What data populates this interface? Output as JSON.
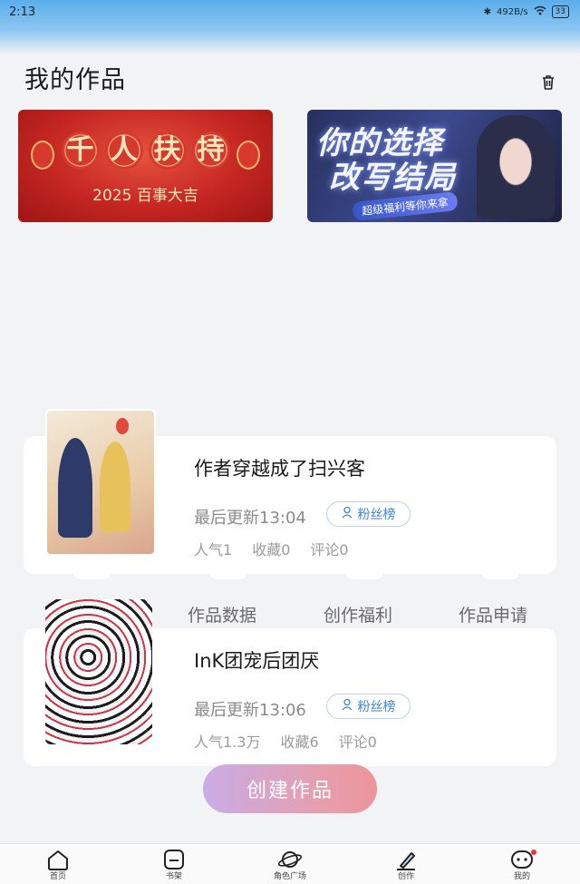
{
  "status_bar": {
    "time": "2:13",
    "network_speed": "492B/s",
    "battery": "33"
  },
  "page": {
    "title": "我的作品"
  },
  "banners": [
    {
      "chars": [
        "千",
        "人",
        "扶",
        "持"
      ],
      "subtitle": "2025 百事大吉"
    },
    {
      "title_line1": "你的选择",
      "title_line2": "改写结局",
      "tagline": "超级福利等你来拿"
    }
  ],
  "works": [
    {
      "title": "作者穿越成了扫兴客",
      "updated": "最后更新13:04",
      "fans_label": "粉丝榜",
      "stats": [
        "人气1",
        "收藏0",
        "评论0"
      ]
    },
    {
      "title": "InK团宠后团厌",
      "updated": "最后更新13:06",
      "fans_label": "粉丝榜",
      "stats": [
        "人气1.3万",
        "收藏6",
        "评论0"
      ]
    }
  ],
  "quick_actions": [
    "作品数据",
    "创作福利",
    "作品申请"
  ],
  "create_button": "创建作品",
  "tabbar": [
    {
      "label": "首页",
      "icon": "home-icon"
    },
    {
      "label": "书架",
      "icon": "bookshelf-icon"
    },
    {
      "label": "角色广场",
      "icon": "planet-icon"
    },
    {
      "label": "创作",
      "icon": "pen-icon"
    },
    {
      "label": "我的",
      "icon": "profile-icon"
    }
  ]
}
